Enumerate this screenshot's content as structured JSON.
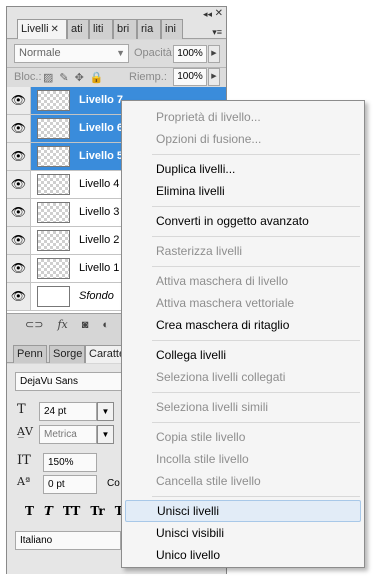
{
  "layers_panel": {
    "tabs": [
      "Livelli",
      "ati",
      "liti",
      "bri",
      "ria",
      "ini"
    ],
    "blend_mode": "Normale",
    "opacity_label": "Opacità:",
    "opacity_value": "100%",
    "lock_label": "Bloc.:",
    "fill_label": "Riemp.:",
    "fill_value": "100%",
    "layers": [
      {
        "name": "Livello 7",
        "selected": true
      },
      {
        "name": "Livello 6",
        "selected": true
      },
      {
        "name": "Livello 5",
        "selected": true
      },
      {
        "name": "Livello 4",
        "selected": false
      },
      {
        "name": "Livello 3",
        "selected": false
      },
      {
        "name": "Livello 2",
        "selected": false
      },
      {
        "name": "Livello 1",
        "selected": false
      },
      {
        "name": "Sfondo",
        "selected": false
      }
    ]
  },
  "character_panel": {
    "tabs": [
      "Penn",
      "Sorge",
      "Caratte"
    ],
    "font_family": "DejaVu Sans",
    "font_size": "24 pt",
    "kerning": "Metrica",
    "vertical_scale": "150%",
    "baseline_shift": "0 pt",
    "color_label": "Co",
    "language": "Italiano",
    "style_buttons": [
      "T",
      "T",
      "TT",
      "Tr",
      "T"
    ]
  },
  "context_menu": {
    "items": [
      {
        "label": "Proprietà di livello...",
        "disabled": true
      },
      {
        "label": "Opzioni di fusione...",
        "disabled": true
      },
      {
        "label": "Duplica livelli...",
        "disabled": false
      },
      {
        "label": "Elimina livelli",
        "disabled": false
      },
      {
        "label": "Converti in oggetto avanzato",
        "disabled": false
      },
      {
        "label": "Rasterizza livelli",
        "disabled": true
      },
      {
        "label": "Attiva maschera di livello",
        "disabled": true
      },
      {
        "label": "Attiva maschera vettoriale",
        "disabled": true
      },
      {
        "label": "Crea maschera di ritaglio",
        "disabled": false
      },
      {
        "label": "Collega livelli",
        "disabled": false
      },
      {
        "label": "Seleziona livelli collegati",
        "disabled": true
      },
      {
        "label": "Seleziona livelli simili",
        "disabled": true
      },
      {
        "label": "Copia stile livello",
        "disabled": true
      },
      {
        "label": "Incolla stile livello",
        "disabled": true
      },
      {
        "label": "Cancella stile livello",
        "disabled": true
      },
      {
        "label": "Unisci livelli",
        "disabled": false,
        "highlighted": true
      },
      {
        "label": "Unisci visibili",
        "disabled": false
      },
      {
        "label": "Unico livello",
        "disabled": false
      }
    ]
  },
  "colors": {
    "selection": "#3a8cdb",
    "menu_highlight": "#e2ecf7",
    "disabled_text": "#8e8e8e"
  }
}
